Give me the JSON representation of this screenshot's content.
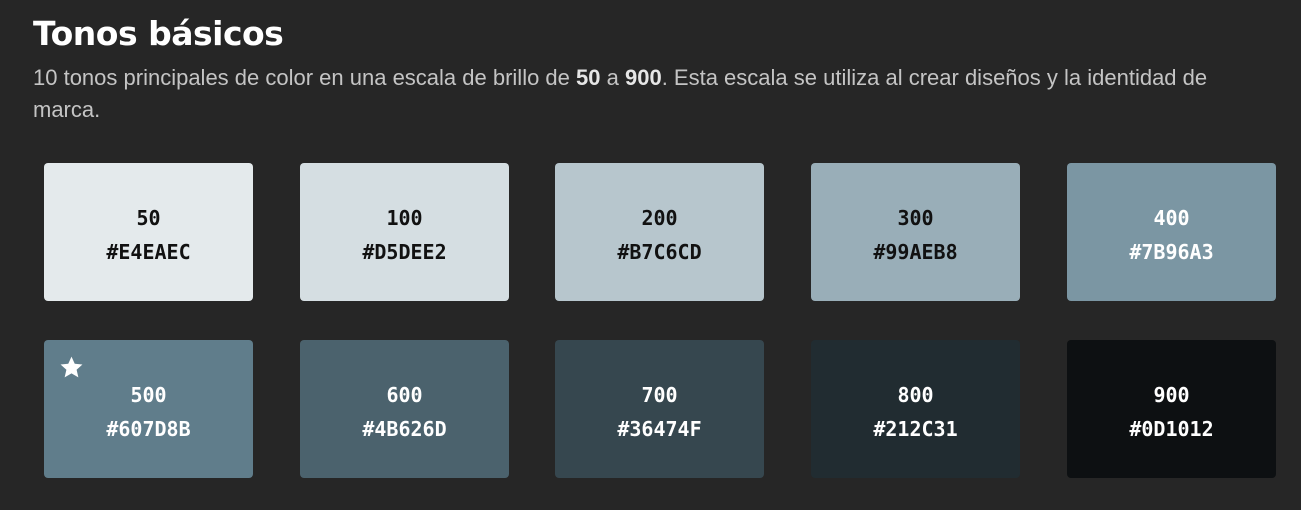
{
  "header": {
    "title": "Tonos básicos",
    "desc_part1": "10 tonos principales de color en una escala de brillo de ",
    "desc_bold1": "50",
    "desc_part2": " a ",
    "desc_bold2": "900",
    "desc_part3": ". Esta escala se utiliza al crear diseños y la identidad de marca."
  },
  "swatches": [
    {
      "shade": "50",
      "hex": "#E4EAEC",
      "text_color": "#111111"
    },
    {
      "shade": "100",
      "hex": "#D5DEE2",
      "text_color": "#111111"
    },
    {
      "shade": "200",
      "hex": "#B7C6CD",
      "text_color": "#111111"
    },
    {
      "shade": "300",
      "hex": "#99AEB8",
      "text_color": "#111111"
    },
    {
      "shade": "400",
      "hex": "#7B96A3",
      "text_color": "#ffffff"
    },
    {
      "shade": "500",
      "hex": "#607D8B",
      "text_color": "#ffffff",
      "starred": true
    },
    {
      "shade": "600",
      "hex": "#4B626D",
      "text_color": "#ffffff"
    },
    {
      "shade": "700",
      "hex": "#36474F",
      "text_color": "#ffffff"
    },
    {
      "shade": "800",
      "hex": "#212C31",
      "text_color": "#ffffff"
    },
    {
      "shade": "900",
      "hex": "#0D1012",
      "text_color": "#ffffff"
    }
  ],
  "star_icon": "star-icon"
}
